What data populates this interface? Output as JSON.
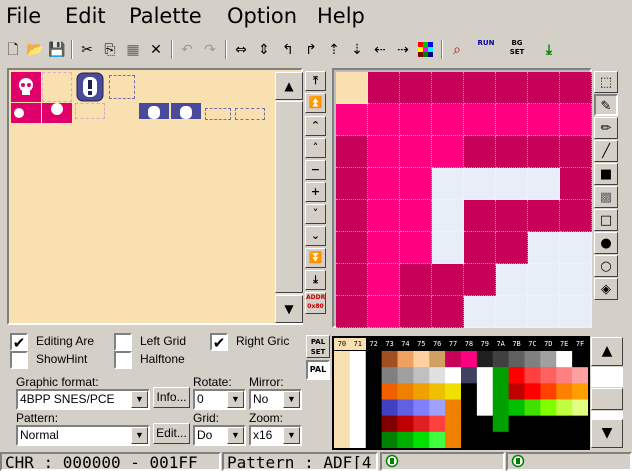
{
  "menu": [
    "File",
    "Edit",
    "Palette",
    "Option",
    "Help"
  ],
  "toolbar": {
    "buttons": [
      "new",
      "open",
      "save",
      "cut",
      "copy",
      "paste",
      "delete",
      "undo",
      "redo",
      "flip-h",
      "flip-v",
      "rotate-left",
      "rotate-right",
      "shift-up",
      "shift-down",
      "shift-left",
      "shift-right",
      "color",
      "find",
      "run",
      "bg-set",
      "export"
    ],
    "run_label": "RUN",
    "bgset_label": "BG SET"
  },
  "nav": {
    "addr_label": "ADDR",
    "addr_value": "0x80"
  },
  "checkboxes": {
    "editing_area": {
      "label": "Editing Are",
      "checked": true
    },
    "left_grid": {
      "label": "Left Grid",
      "checked": false
    },
    "right_grid": {
      "label": "Right Gric",
      "checked": true
    },
    "show_hint": {
      "label": "ShowHint",
      "checked": false
    },
    "halftone": {
      "label": "Halftone",
      "checked": false
    }
  },
  "fields": {
    "graphic_format_label": "Graphic format:",
    "graphic_format_value": "4BPP SNES/PCE",
    "info_button": "Info...",
    "rotate_label": "Rotate:",
    "rotate_value": "0",
    "mirror_label": "Mirror:",
    "mirror_value": "No",
    "pattern_label": "Pattern:",
    "pattern_value": "Normal",
    "edit_button": "Edit...",
    "grid_label": "Grid:",
    "grid_value": "Do",
    "zoom_label": "Zoom:",
    "zoom_value": "x16"
  },
  "pal": {
    "set_label": "PAL SET",
    "pal_label": "PAL"
  },
  "palette_header": [
    "70",
    "71",
    "72",
    "73",
    "74",
    "75",
    "76",
    "77",
    "78",
    "79",
    "7A",
    "7B",
    "7C",
    "7D",
    "7E",
    "7F"
  ],
  "editor_colors": {
    "peach": "#f8e0b0",
    "dark": "#c8005a",
    "pink": "#ff0080",
    "white": "#e8eef8"
  },
  "editor_rows": [
    "PDDDDDDD",
    "PPPPPPPP",
    "DPPPDDDD",
    "DPPWWWWD",
    "DPPWDDDD",
    "DPPWDDWW",
    "DPDDDWWW",
    "DPDDWWWW"
  ],
  "status": {
    "chr": "CHR : 000000 - 001FF",
    "pattern": "Pattern : ADF[4"
  }
}
